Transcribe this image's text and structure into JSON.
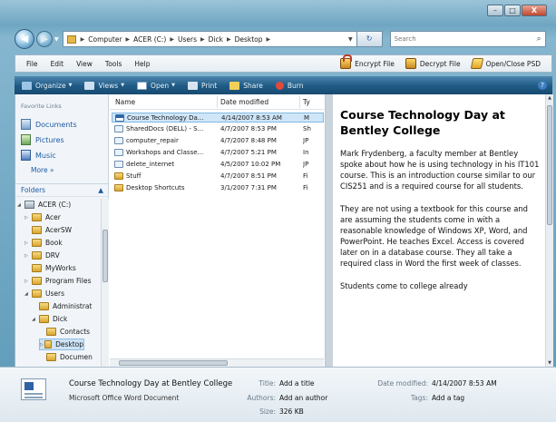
{
  "window": {
    "minimize_label": "–",
    "maximize_label": "□",
    "close_label": "X"
  },
  "address": {
    "back_label": "◀",
    "forward_label": "▶",
    "crumbs": [
      "Computer",
      "ACER (C:)",
      "Users",
      "Dick",
      "Desktop"
    ],
    "search_placeholder": "Search"
  },
  "menubar": {
    "items": [
      "File",
      "Edit",
      "View",
      "Tools",
      "Help"
    ],
    "tools": [
      "Encrypt File",
      "Decrypt File",
      "Open/Close PSD"
    ]
  },
  "cmdbar": {
    "items": [
      "Organize",
      "Views",
      "Open",
      "Print",
      "Share",
      "Burn"
    ]
  },
  "navpane": {
    "favorites_title": "Favorite Links",
    "favorites": [
      "Documents",
      "Pictures",
      "Music"
    ],
    "more_label": "More »",
    "folders_label": "Folders",
    "tree": [
      {
        "label": "ACER (C:)",
        "level": 0,
        "arrow": "◢",
        "type": "drive"
      },
      {
        "label": "Acer",
        "level": 1,
        "arrow": "▷",
        "type": "folder"
      },
      {
        "label": "AcerSW",
        "level": 1,
        "arrow": "",
        "type": "folder"
      },
      {
        "label": "Book",
        "level": 1,
        "arrow": "▷",
        "type": "folder"
      },
      {
        "label": "DRV",
        "level": 1,
        "arrow": "▷",
        "type": "folder"
      },
      {
        "label": "MyWorks",
        "level": 1,
        "arrow": "",
        "type": "folder"
      },
      {
        "label": "Program Files",
        "level": 1,
        "arrow": "▷",
        "type": "folder"
      },
      {
        "label": "Users",
        "level": 1,
        "arrow": "◢",
        "type": "folder"
      },
      {
        "label": "Administrat",
        "level": 2,
        "arrow": "",
        "type": "folder"
      },
      {
        "label": "Dick",
        "level": 2,
        "arrow": "◢",
        "type": "folder"
      },
      {
        "label": "Contacts",
        "level": 3,
        "arrow": "",
        "type": "folder"
      },
      {
        "label": "Desktop",
        "level": 3,
        "arrow": "▷",
        "type": "folder",
        "selected": true
      },
      {
        "label": "Documen",
        "level": 3,
        "arrow": "",
        "type": "folder"
      }
    ]
  },
  "filelist": {
    "columns": [
      "Name",
      "Date modified",
      "Ty"
    ],
    "rows": [
      {
        "name": "Course Technology Da...",
        "date": "4/14/2007 8:53 AM",
        "type": "M",
        "icon": "doc",
        "selected": true
      },
      {
        "name": "SharedDocs (DELL) - S...",
        "date": "4/7/2007 8:53 PM",
        "type": "Sh",
        "icon": "link"
      },
      {
        "name": "computer_repair",
        "date": "4/7/2007 8:48 PM",
        "type": "JP",
        "icon": "link"
      },
      {
        "name": "Workshops and Classe...",
        "date": "4/7/2007 5:21 PM",
        "type": "In",
        "icon": "link"
      },
      {
        "name": "delete_internet",
        "date": "4/5/2007 10:02 PM",
        "type": "JP",
        "icon": "link"
      },
      {
        "name": "Stuff",
        "date": "4/7/2007 8:51 PM",
        "type": "Fi",
        "icon": "folder"
      },
      {
        "name": "Desktop Shortcuts",
        "date": "3/1/2007 7:31 PM",
        "type": "Fi",
        "icon": "folder"
      }
    ]
  },
  "preview": {
    "title": "Course Technology Day at Bentley College",
    "paragraphs": [
      "Mark Frydenberg, a faculty member at Bentley spoke about how he is using technology in his IT101 course. This is an introduction course similar to our CIS251 and is a required course for all students.",
      "They are not using a textbook for this course and are assuming the students come in with a reasonable knowledge of Windows XP, Word, and PowerPoint. He teaches Excel. Access is covered later on in a database course. They all take a required class in Word the first week of classes.",
      "Students come to college already"
    ]
  },
  "details": {
    "name": "Course Technology Day at Bentley College",
    "type": "Microsoft Office Word Document",
    "title_label": "Title:",
    "title_value": "Add a title",
    "authors_label": "Authors:",
    "authors_value": "Add an author",
    "size_label": "Size:",
    "size_value": "326 KB",
    "date_label": "Date modified:",
    "date_value": "4/14/2007 8:53 AM",
    "tags_label": "Tags:",
    "tags_value": "Add a tag"
  }
}
